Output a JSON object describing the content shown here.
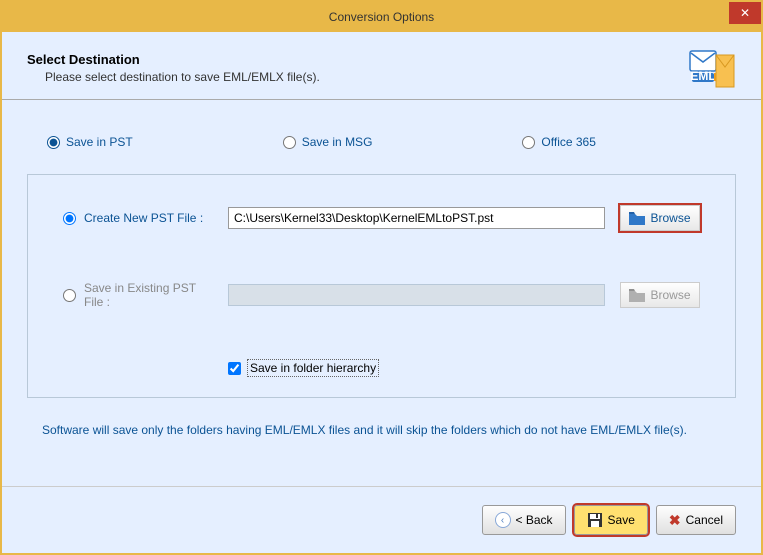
{
  "title": "Conversion Options",
  "header": {
    "title": "Select Destination",
    "subtitle": "Please select destination to save EML/EMLX file(s)."
  },
  "save_options": {
    "pst": "Save in PST",
    "msg": "Save in MSG",
    "office365": "Office 365"
  },
  "create_new": {
    "label": "Create New PST File :",
    "path": "C:\\Users\\Kernel33\\Desktop\\KernelEMLtoPST.pst",
    "browse": "Browse"
  },
  "existing": {
    "label": "Save in Existing PST File :",
    "path": "",
    "browse": "Browse"
  },
  "hierarchy_label": "Save in folder hierarchy",
  "note": "Software will save only the folders having EML/EMLX files and it will skip the folders which do not have EML/EMLX file(s).",
  "buttons": {
    "back": "< Back",
    "save": "Save",
    "cancel": "Cancel"
  }
}
